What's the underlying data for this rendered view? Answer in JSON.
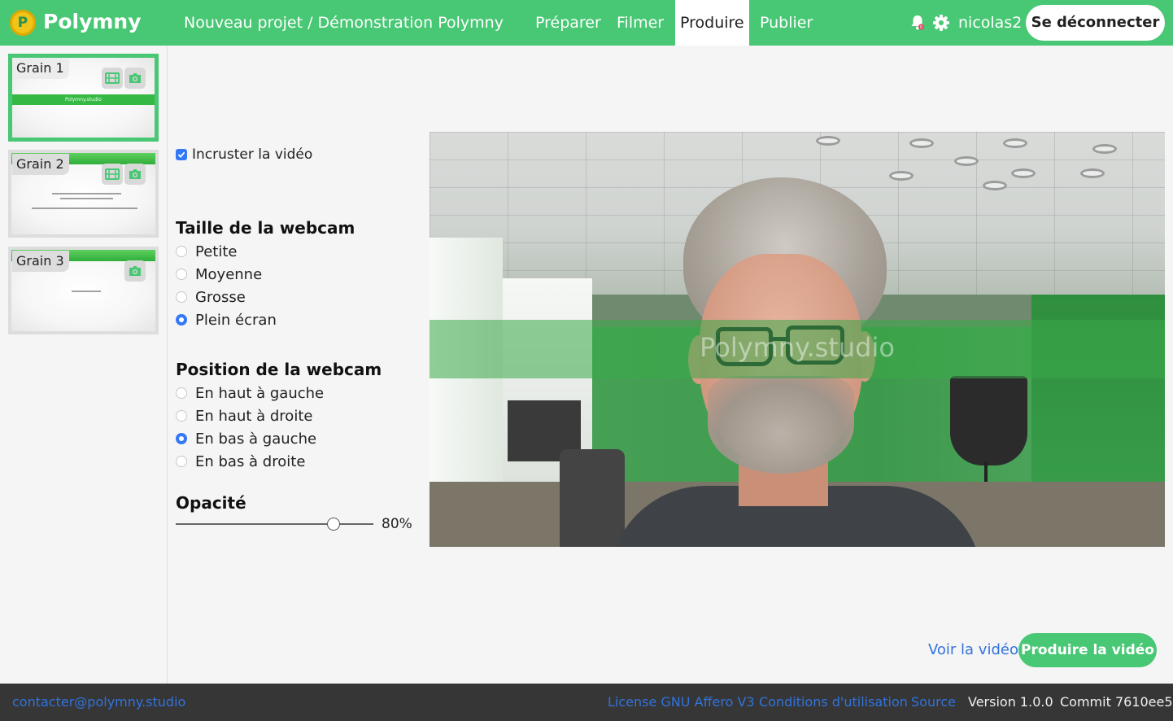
{
  "navbar": {
    "brand": "Polymny",
    "project": "Nouveau projet / Démonstration Polymny",
    "tabs": [
      {
        "label": "Préparer",
        "active": false
      },
      {
        "label": "Filmer",
        "active": false
      },
      {
        "label": "Produire",
        "active": true
      },
      {
        "label": "Publier",
        "active": false
      }
    ],
    "notification_count": "0",
    "username": "nicolas2",
    "logout_label": "Se déconnecter"
  },
  "sidebar": {
    "grains": [
      {
        "label": "Grain 1",
        "thumbnail_text": "Polymny.studio",
        "active": true,
        "icons": [
          "film-icon",
          "camera-icon"
        ]
      },
      {
        "label": "Grain 2",
        "active": false,
        "icons": [
          "film-icon",
          "camera-icon"
        ]
      },
      {
        "label": "Grain 3",
        "active": false,
        "icons": [
          "camera-icon"
        ]
      }
    ]
  },
  "settings": {
    "embed_video_label": "Incruster la vidéo",
    "embed_video_checked": true,
    "size_title": "Taille de la webcam",
    "size_options": [
      "Petite",
      "Moyenne",
      "Grosse",
      "Plein écran"
    ],
    "size_selected": "Plein écran",
    "position_title": "Position de la webcam",
    "position_options": [
      "En haut à gauche",
      "En haut à droite",
      "En bas à gauche",
      "En bas à droite"
    ],
    "position_selected": "En bas à gauche",
    "opacity_title": "Opacité",
    "opacity_value": 0.8,
    "opacity_label": "80%"
  },
  "preview": {
    "overlay_text": "Polymny.studio",
    "accent_color": "#48c774"
  },
  "actions": {
    "view_video_label": "Voir la vidéo",
    "produce_video_label": "Produire la vidéo"
  },
  "footer": {
    "contact": "contacter@polymny.studio",
    "license": "License GNU Affero V3",
    "terms": "Conditions d'utilisation",
    "source": "Source",
    "version": "Version 1.0.0",
    "commit": "Commit 7610ee5"
  },
  "colors": {
    "brand_green": "#48c774",
    "link_blue": "#3273dc",
    "radio_blue": "#3478f6",
    "footer_bg": "#363636"
  }
}
